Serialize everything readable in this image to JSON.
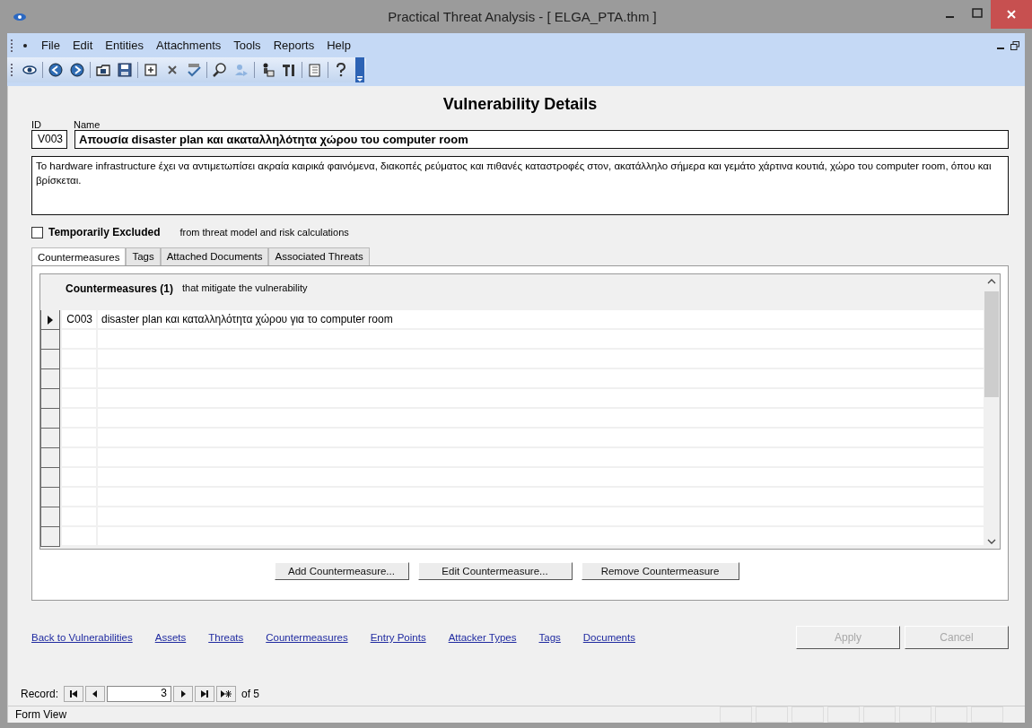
{
  "window": {
    "title": "Practical Threat Analysis - [ ELGA_PTA.thm ]"
  },
  "menu": [
    "File",
    "Edit",
    "Entities",
    "Attachments",
    "Tools",
    "Reports",
    "Help"
  ],
  "form": {
    "heading": "Vulnerability Details",
    "id_label": "ID",
    "name_label": "Name",
    "id": "V003",
    "name": "Απουσία disaster plan και ακαταλληλότητα χώρου του computer room",
    "description": "Το hardware infrastructure έχει να αντιμετωπίσει ακραία καιρικά φαινόμενα, διακοπές ρεύματος και πιθανές καταστροφές στον, ακατάλληλο σήμερα και γεμάτο χάρτινα κουτιά, χώρο του computer room, όπου και βρίσκεται.",
    "excluded": {
      "label": "Temporarily Excluded",
      "note": "from threat model and risk calculations",
      "checked": false
    }
  },
  "tabs": [
    {
      "label": "Countermeasures",
      "selected": true
    },
    {
      "label": "Tags",
      "selected": false
    },
    {
      "label": "Attached Documents",
      "selected": false
    },
    {
      "label": "Associated Threats",
      "selected": false
    }
  ],
  "countermeasures": {
    "title": "Countermeasures (1)",
    "subtitle": "that mitigate the vulnerability",
    "rows": [
      {
        "id": "C003",
        "name": "disaster plan και καταλληλότητα χώρου για το  computer room",
        "current": true
      }
    ],
    "buttons": [
      {
        "label": "Add Countermeasure..."
      },
      {
        "label": "Edit Countermeasure..."
      },
      {
        "label": "Remove Countermeasure"
      }
    ]
  },
  "links": [
    "Back to Vulnerabilities",
    "Assets",
    "Threats",
    "Countermeasures",
    "Entry Points",
    "Attacker Types",
    "Tags",
    "Documents"
  ],
  "actions": [
    {
      "label": "Apply",
      "disabled": true
    },
    {
      "label": "Cancel",
      "disabled": true
    }
  ],
  "record": {
    "label": "Record:",
    "value": "3",
    "total": "of 5"
  },
  "status_bar": "Form View"
}
